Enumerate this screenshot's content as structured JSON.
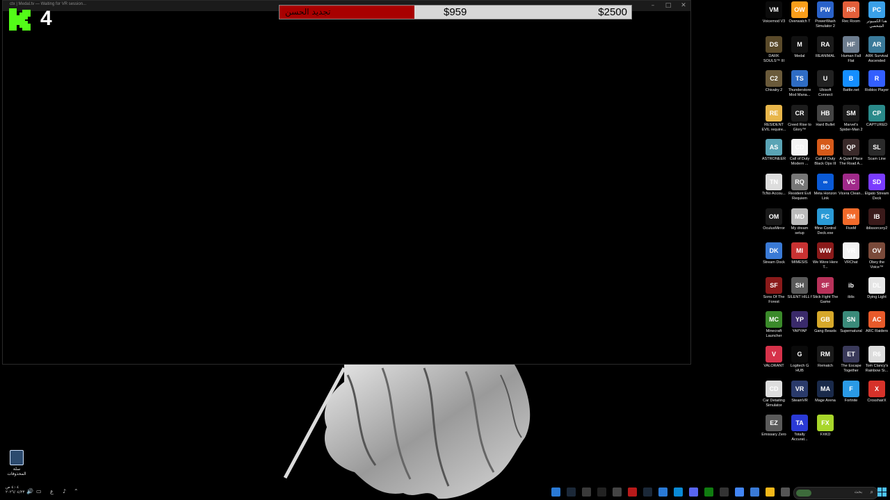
{
  "window": {
    "title": "ctx | Medal.tv — Waiting for VR session...",
    "controls": [
      "–",
      "□",
      "✕"
    ],
    "k_count": "4"
  },
  "donation_bar": {
    "label": "تجديد الحسن",
    "current": "$959",
    "goal": "$2500",
    "progress": 0.3836,
    "fill_color": "#a80000",
    "track_color": "#d7d7d7"
  },
  "recycle_bin": {
    "label": "سلة المحذوفات",
    "icon": "recycle-bin-icon"
  },
  "desktop_icons": [
    {
      "label": "Voicemod V3",
      "color": "#0b0b0b",
      "glyph": "VM"
    },
    {
      "label": "Overwatch T",
      "color": "#f99e1a",
      "glyph": "OW"
    },
    {
      "label": "PowerWash Simulator 2",
      "color": "#2a62c9",
      "glyph": "PW"
    },
    {
      "label": "Rec Room",
      "color": "#e35f3a",
      "glyph": "RR"
    },
    {
      "label": "هذا الكمبيوتر الشخصي",
      "color": "#3aa0e8",
      "glyph": "PC"
    },
    {
      "label": "DARK SOULS™ III",
      "color": "#5a4a2a",
      "glyph": "DS"
    },
    {
      "label": "Medal",
      "color": "#111111",
      "glyph": "M"
    },
    {
      "label": "REANIMAL",
      "color": "#1a1a1a",
      "glyph": "RA"
    },
    {
      "label": "Human Fall Flat",
      "color": "#6d7d8f",
      "glyph": "HF"
    },
    {
      "label": "ARK Survival Ascended",
      "color": "#3a7a9a",
      "glyph": "AR"
    },
    {
      "label": "Chivalry 2",
      "color": "#6a5a3a",
      "glyph": "C2"
    },
    {
      "label": "Thunderstore Mod Mana...",
      "color": "#2e6cc4",
      "glyph": "TS"
    },
    {
      "label": "Ubisoft Connect",
      "color": "#222222",
      "glyph": "U"
    },
    {
      "label": "Battle.net",
      "color": "#148eff",
      "glyph": "B"
    },
    {
      "label": "Roblox Player",
      "color": "#335fff",
      "glyph": "R"
    },
    {
      "label": "RESIDENT EVIL require...",
      "color": "#e8b64a",
      "glyph": "RE"
    },
    {
      "label": "Creed Rise to Glory™",
      "color": "#1c1c1c",
      "glyph": "CR"
    },
    {
      "label": "Hard Bullet",
      "color": "#444444",
      "glyph": "HB"
    },
    {
      "label": "Marvel's Spider-Man 2",
      "color": "#1b1b1b",
      "glyph": "SM"
    },
    {
      "label": "CAPTURED",
      "color": "#2a8a8a",
      "glyph": "CP"
    },
    {
      "label": "ASTRONEER",
      "color": "#5aa4b5",
      "glyph": "AS"
    },
    {
      "label": "Call of Duty Modern ...",
      "color": "#f4f4f4",
      "glyph": "CD"
    },
    {
      "label": "Call of Duty Black Ops III",
      "color": "#d65a1a",
      "glyph": "BO"
    },
    {
      "label": "A Quiet Place The Road A...",
      "color": "#3a2a2a",
      "glyph": "QP"
    },
    {
      "label": "Scam Line",
      "color": "#2a2a2a",
      "glyph": "SL"
    },
    {
      "label": "TcNo Accou...",
      "color": "#dddddd",
      "glyph": "TN"
    },
    {
      "label": "Resident Evil Requiem",
      "color": "#777777",
      "glyph": "RQ"
    },
    {
      "label": "Meta Horizon Link",
      "color": "#0a5ad6",
      "glyph": "∞"
    },
    {
      "label": "Vicera Clean...",
      "color": "#a02a8a",
      "glyph": "VC"
    },
    {
      "label": "Elgato Stream Deck",
      "color": "#7a3cff",
      "glyph": "SD"
    },
    {
      "label": "OculusMirror",
      "color": "#1a1a1a",
      "glyph": "OM"
    },
    {
      "label": "My dream setup",
      "color": "#bbbbbb",
      "glyph": "MD"
    },
    {
      "label": "fifine Control Deck.exe",
      "color": "#2a9ad6",
      "glyph": "FC"
    },
    {
      "label": "FiveM",
      "color": "#f26a2a",
      "glyph": "5M"
    },
    {
      "label": "iblissorcery2",
      "color": "#3a1a1a",
      "glyph": "IB"
    },
    {
      "label": "Stream Dock",
      "color": "#3a7ad6",
      "glyph": "DK"
    },
    {
      "label": "MIMESIS",
      "color": "#c83232",
      "glyph": "MI"
    },
    {
      "label": "We Were Here T...",
      "color": "#8a1a1a",
      "glyph": "WW"
    },
    {
      "label": "VRChat",
      "color": "#f4f4f4",
      "glyph": "VR"
    },
    {
      "label": "Obey the Voice™",
      "color": "#7a4a3a",
      "glyph": "OV"
    },
    {
      "label": "Sons Of The Forest",
      "color": "#8a1a1a",
      "glyph": "SF"
    },
    {
      "label": "SILENT HILL f",
      "color": "#5a5a5a",
      "glyph": "SH"
    },
    {
      "label": "Stick Fight The Game",
      "color": "#b8325a",
      "glyph": "SF"
    },
    {
      "label": "iblis",
      "color": "#000000",
      "glyph": "ib"
    },
    {
      "label": "Dying Light",
      "color": "#e6e6e6",
      "glyph": "DL"
    },
    {
      "label": "Minecraft Launcher",
      "color": "#3a8a2a",
      "glyph": "MC"
    },
    {
      "label": "YAPYAP",
      "color": "#3a2a6a",
      "glyph": "YP"
    },
    {
      "label": "Gang Beasts",
      "color": "#d6a82a",
      "glyph": "GB"
    },
    {
      "label": "Supernatural",
      "color": "#3a8a7a",
      "glyph": "SN"
    },
    {
      "label": "ARC Raiders",
      "color": "#e85a2a",
      "glyph": "AC"
    },
    {
      "label": "VALORANT",
      "color": "#d6324a",
      "glyph": "V"
    },
    {
      "label": "Logitech G HUB",
      "color": "#0a0a0a",
      "glyph": "G"
    },
    {
      "label": "Rematch",
      "color": "#1a1a1a",
      "glyph": "RM"
    },
    {
      "label": "The Escape Together",
      "color": "#3a3a5a",
      "glyph": "ET"
    },
    {
      "label": "Tom Clancy's Rainbow Si...",
      "color": "#dddddd",
      "glyph": "R6"
    },
    {
      "label": "Car Detailing Simulator",
      "color": "#dddddd",
      "glyph": "CD"
    },
    {
      "label": "SteamVR",
      "color": "#2a3a6a",
      "glyph": "VR"
    },
    {
      "label": "Mage Arena",
      "color": "#1a2a4a",
      "glyph": "MA"
    },
    {
      "label": "Fortnite",
      "color": "#2a9ae6",
      "glyph": "F"
    },
    {
      "label": "CrosshairX",
      "color": "#d6322a",
      "glyph": "X"
    },
    {
      "label": "Emissary Zero",
      "color": "#5a5a5a",
      "glyph": "EZ"
    },
    {
      "label": "Totally Accurat...",
      "color": "#2a3ad6",
      "glyph": "TA"
    },
    {
      "label": "FXKD",
      "color": "#a8d62a",
      "glyph": "FX"
    }
  ],
  "taskbar": {
    "time": "٤:٠٤ ص",
    "date": "٢٠٢٦/٠٤/٢٣",
    "lang": "ع",
    "search_placeholder": "بحث",
    "pinned": [
      {
        "name": "notepad-icon",
        "color": "#2a7ad6"
      },
      {
        "name": "steam-icon",
        "color": "#1b2838"
      },
      {
        "name": "obs-icon",
        "color": "#3a3a3a"
      },
      {
        "name": "medal-icon",
        "color": "#222222"
      },
      {
        "name": "terminal-icon",
        "color": "#444444"
      },
      {
        "name": "capture-icon",
        "color": "#b81a1a"
      },
      {
        "name": "steam-2-icon",
        "color": "#1b2838"
      },
      {
        "name": "vscode-icon",
        "color": "#2a7ad6"
      },
      {
        "name": "edge-icon",
        "color": "#0a8ad6"
      },
      {
        "name": "discord-icon",
        "color": "#5865f2"
      },
      {
        "name": "xbox-icon",
        "color": "#107c10"
      },
      {
        "name": "epic-icon",
        "color": "#333333"
      },
      {
        "name": "chrome-icon",
        "color": "#4285f4"
      },
      {
        "name": "store-icon",
        "color": "#3a7ad6"
      },
      {
        "name": "explorer-icon",
        "color": "#f4b81a"
      },
      {
        "name": "taskview-icon",
        "color": "#555555"
      }
    ]
  }
}
